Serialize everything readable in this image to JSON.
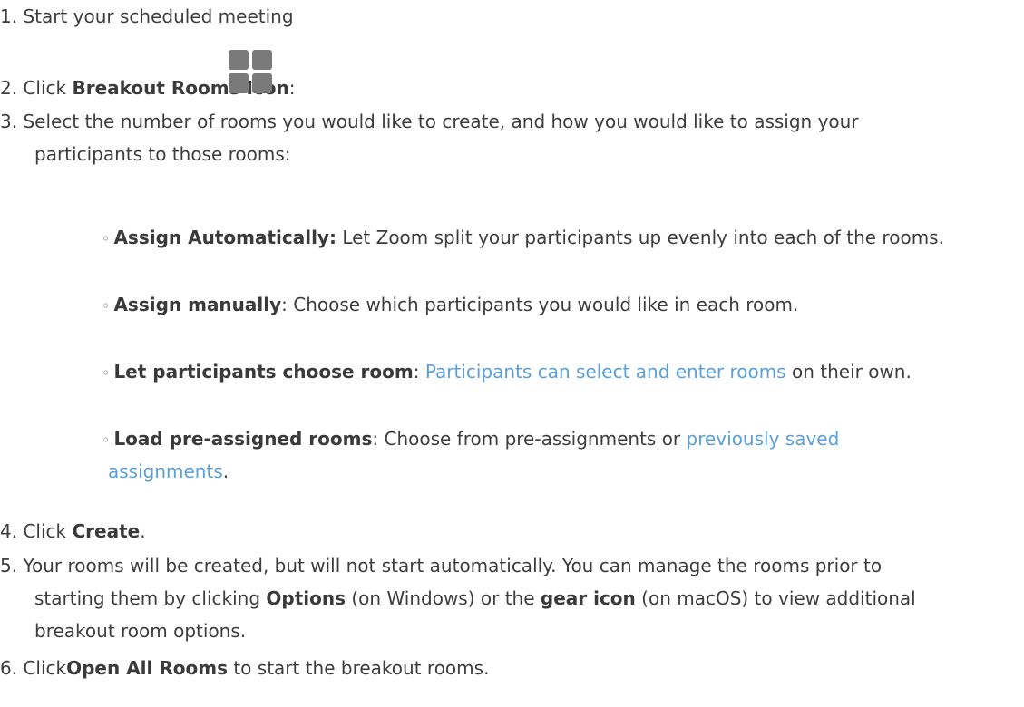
{
  "steps": {
    "s1": {
      "num": "1.",
      "text": "Start your scheduled meeting"
    },
    "s2": {
      "num": "2.",
      "pre": "Click ",
      "bold": "Breakout Rooms Icon",
      "post": ":",
      "icon": "breakout-rooms-icon",
      "icon_color": "#7a7a7a"
    },
    "s3": {
      "num": "3.",
      "line1": "Select the number of rooms you would like to create, and how you would like to assign your",
      "line2": "participants to those rooms:"
    },
    "s4": {
      "num": "4.",
      "pre": "Click ",
      "bold": "Create",
      "post": "."
    },
    "s5": {
      "num": "5.",
      "line1": "Your rooms will be created, but will not start automatically. You can manage the rooms prior to",
      "line2_pre": "starting them by clicking ",
      "line2_bold1": "Options",
      "line2_mid": " (on Windows) or the ",
      "line2_bold2": "gear icon",
      "line2_post": " (on macOS) to view additional",
      "line3": "breakout room options."
    },
    "s6": {
      "num": "6.",
      "pre": "Click",
      "bold": "Open All Rooms",
      "post": " to start the breakout rooms."
    }
  },
  "options": {
    "bullet": "◦",
    "o1": {
      "bold": "Assign Automatically:",
      "text": " Let Zoom split your participants up evenly into each of the rooms."
    },
    "o2": {
      "bold": "Assign manually",
      "text": ": Choose which participants you would like in each room."
    },
    "o3": {
      "bold": "Let participants choose room",
      "pre": ": ",
      "link": "Participants can select and enter rooms",
      "post": " on their own."
    },
    "o4": {
      "bold": "Load pre-assigned rooms",
      "pre": ": Choose from pre-assignments or ",
      "link1": "previously saved",
      "link2": "assignments",
      "post": "."
    }
  },
  "colors": {
    "text": "#3d3d3d",
    "link": "#5a9fd6"
  }
}
